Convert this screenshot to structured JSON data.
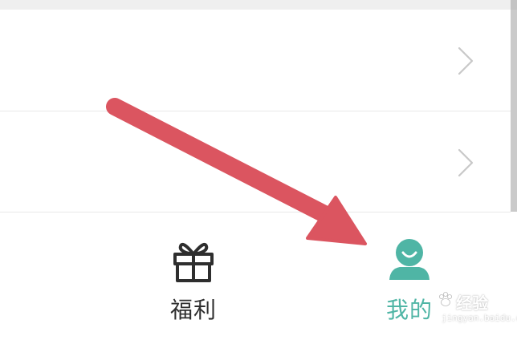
{
  "colors": {
    "accent": "#4fb5a5",
    "arrow": "#db5560",
    "chevron": "#c8c8c8",
    "divider": "#e8e8e8",
    "label_dark": "#2e2e2e"
  },
  "list": {
    "rows": [
      {
        "chevron_icon": "chevron-right-icon"
      },
      {
        "chevron_icon": "chevron-right-icon"
      }
    ]
  },
  "tabbar": {
    "tabs": [
      {
        "label": "福利",
        "icon": "gift-icon",
        "active": false
      },
      {
        "label": "我的",
        "icon": "person-icon",
        "active": true
      }
    ]
  },
  "overlay": {
    "annotation_icon": "arrow-annotation"
  },
  "watermark": {
    "text": "经验",
    "sub": "jingyan.baidu.com"
  }
}
